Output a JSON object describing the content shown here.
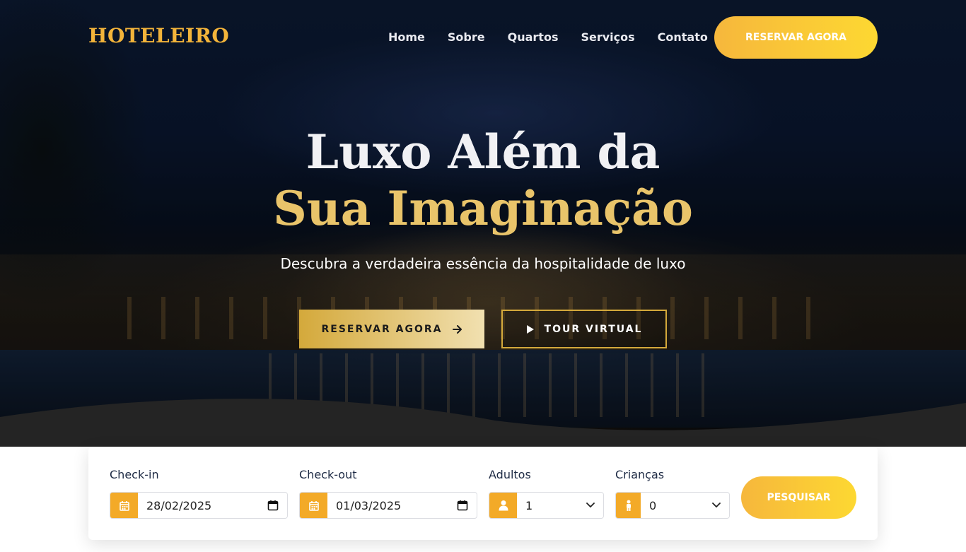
{
  "header": {
    "logo": "HOTELEIRO",
    "nav": [
      {
        "label": "Home"
      },
      {
        "label": "Sobre"
      },
      {
        "label": "Quartos"
      },
      {
        "label": "Serviços"
      },
      {
        "label": "Contato"
      }
    ],
    "cta_label": "RESERVAR AGORA"
  },
  "hero": {
    "headline_line1": "Luxo Além da",
    "headline_line2": "Sua Imaginação",
    "subtitle": "Descubra a verdadeira essência da hospitalidade de luxo",
    "primary_button": "RESERVAR AGORA",
    "secondary_button": "TOUR VIRTUAL"
  },
  "booking": {
    "checkin": {
      "label": "Check-in",
      "value": "28/02/2025",
      "icon": "calendar-icon"
    },
    "checkout": {
      "label": "Check-out",
      "value": "01/03/2025",
      "icon": "calendar-icon"
    },
    "adults": {
      "label": "Adultos",
      "value": "1",
      "icon": "user-icon"
    },
    "children": {
      "label": "Crianças",
      "value": "0",
      "icon": "child-icon"
    },
    "search_label": "PESQUISAR"
  },
  "colors": {
    "accent": "#f3aa28",
    "gold_text": "#e9c46a",
    "logo": "#f3b43a",
    "dark_wave": "#242424"
  }
}
